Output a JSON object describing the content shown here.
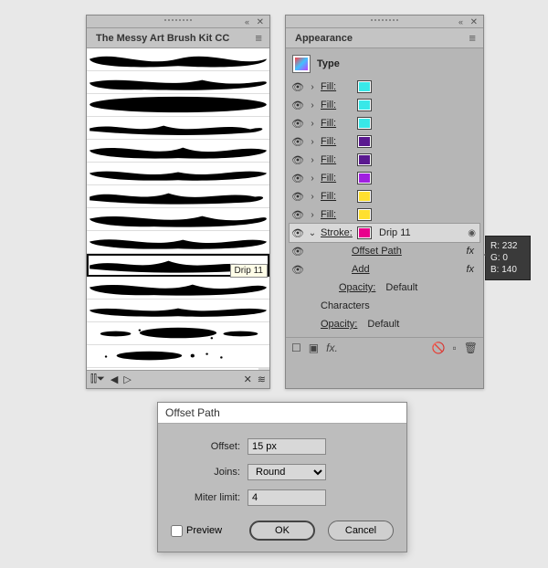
{
  "brushes_panel": {
    "title": "The Messy Art Brush Kit CC",
    "tooltip": "Drip 11",
    "selected_index": 9,
    "items_count": 14
  },
  "appearance_panel": {
    "title": "Appearance",
    "type_label": "Type",
    "fill_label": "Fill:",
    "stroke_label": "Stroke:",
    "offset_path_label": "Offset Path",
    "add_label": "Add",
    "opacity_label": "Opacity:",
    "opacity_value": "Default",
    "characters_label": "Characters",
    "fx_label": "fx",
    "stroke_value": "Drip 11",
    "fills": [
      {
        "color": "#38e8e8"
      },
      {
        "color": "#38e8e8"
      },
      {
        "color": "#38e8e8"
      },
      {
        "color": "#5a1990"
      },
      {
        "color": "#5a1990"
      },
      {
        "color": "#a020e0"
      },
      {
        "color": "#ffe030"
      },
      {
        "color": "#ffe030"
      }
    ],
    "stroke_color": "#e8008c"
  },
  "rgb": {
    "r": "R: 232",
    "g": "G: 0",
    "b": "B: 140"
  },
  "dialog": {
    "title": "Offset Path",
    "offset_label": "Offset:",
    "offset_value": "15 px",
    "joins_label": "Joins:",
    "joins_value": "Round",
    "miter_label": "Miter limit:",
    "miter_value": "4",
    "preview_label": "Preview",
    "ok": "OK",
    "cancel": "Cancel"
  }
}
